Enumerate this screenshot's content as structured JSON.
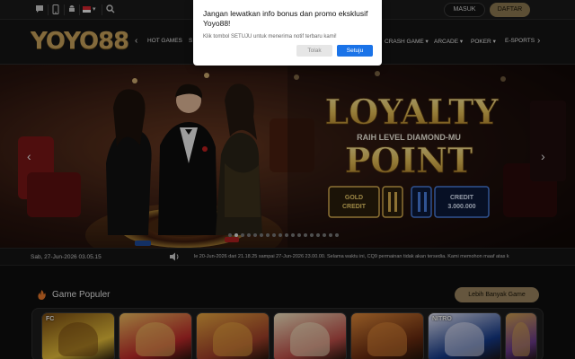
{
  "topbar": {
    "icons": [
      "chat-icon",
      "phone-icon",
      "android-icon",
      "flag-id-icon",
      "search-icon"
    ],
    "login_label": "MASUK",
    "register_label": "DAFTAR"
  },
  "brand": {
    "logo_text": "YOYO88"
  },
  "nav": {
    "items": [
      "HOT GAMES",
      "S",
      "CRASH GAME",
      "ARCADE",
      "POKER",
      "E-SPORTS"
    ],
    "dropdown_caret": "▾"
  },
  "hero": {
    "headline_1": "LOYALTY",
    "tagline": "RAIH LEVEL DIAMOND-MU",
    "headline_2": "POINT",
    "gold_credit": "GOLD CREDIT",
    "credit_label": "CREDIT",
    "credit_amount": "3.000.000",
    "slide_count": 18,
    "active_slide": 1
  },
  "strip": {
    "datetime": "Sab, 27-Jun-2026 03.05.15",
    "announcement": "le 20-Jun-2026 dari 21.18.25 sampai 27-Jun-2026 23.00.00. Selama waktu ini, CQ9 permainan tidak akan tersedia. Kami memohon maaf atas k"
  },
  "games": {
    "title": "Game Populer",
    "more_label": "Lebih Banyak Game",
    "cards": [
      {
        "name": "game-card-fc-fortune",
        "badge": "FC",
        "colors": [
          "#e9c13b",
          "#7a4b12"
        ]
      },
      {
        "name": "game-card-fortune-mouse",
        "badge": "",
        "colors": [
          "#c02a2a",
          "#f0c060"
        ]
      },
      {
        "name": "game-card-fortune-goddess",
        "badge": "",
        "colors": [
          "#a2402a",
          "#e9a840"
        ]
      },
      {
        "name": "game-card-mahjong",
        "badge": "",
        "colors": [
          "#c0504a",
          "#f3e6c2"
        ]
      },
      {
        "name": "game-card-wild-west",
        "badge": "",
        "colors": [
          "#6a2b10",
          "#e08a3a"
        ]
      },
      {
        "name": "game-card-nitro",
        "badge": "NITRO",
        "colors": [
          "#153a8a",
          "#e8e8f8"
        ]
      },
      {
        "name": "game-card-partial",
        "badge": "",
        "colors": [
          "#6a3a8a",
          "#d0a050"
        ]
      }
    ]
  },
  "popup": {
    "title": "Jangan lewatkan info bonus dan promo eksklusif Yoyo88!",
    "message": "Klik tombol SETUJU untuk menerima notif terbaru kami!",
    "decline_label": "Tolak",
    "accept_label": "Setuju"
  },
  "colors": {
    "gold": "#c9a45c",
    "accent_blue": "#1a73e8",
    "daftar_bg": "#8e7a52"
  }
}
